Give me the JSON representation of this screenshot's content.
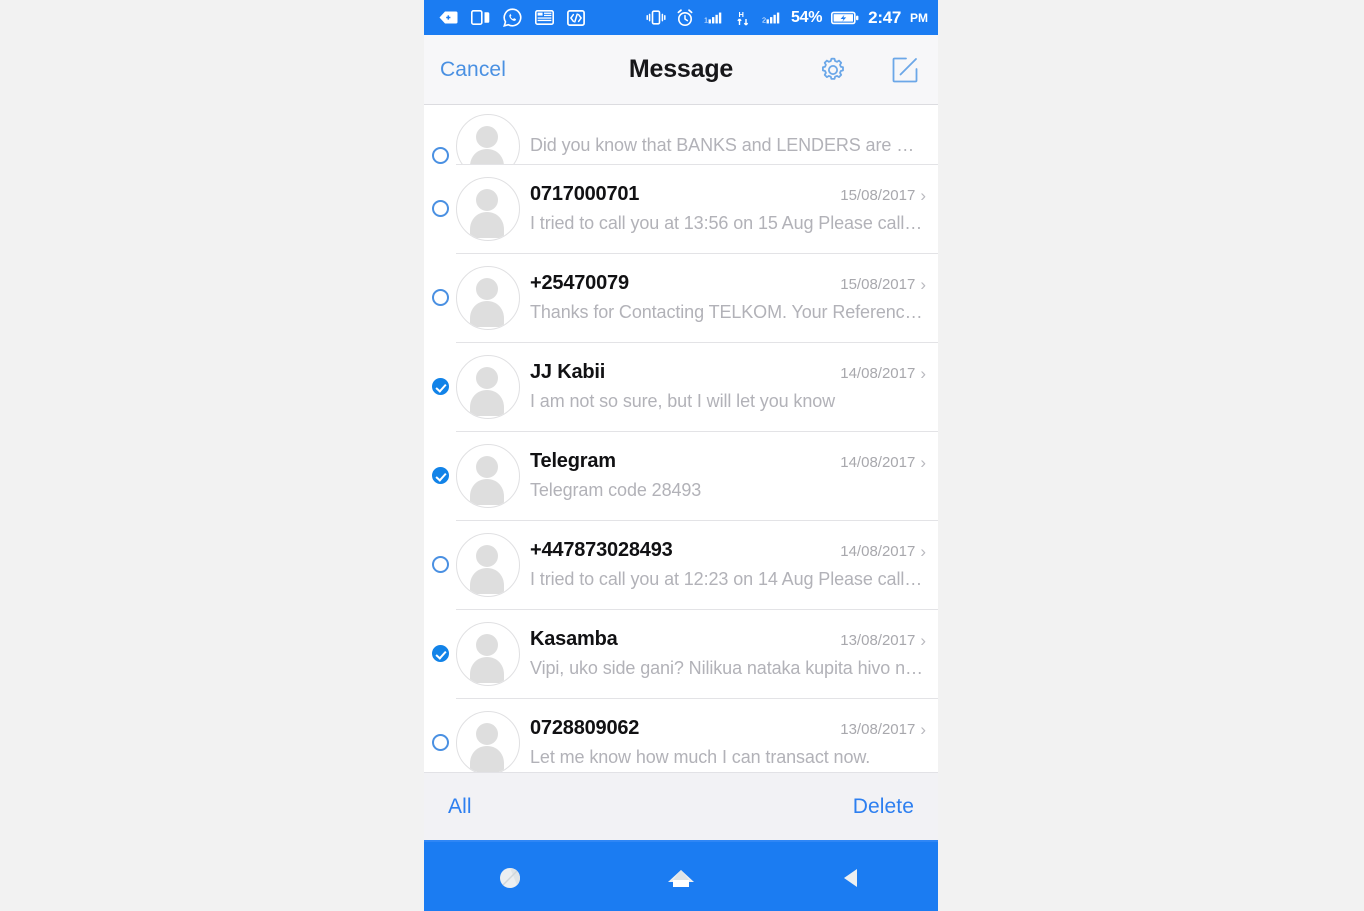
{
  "colors": {
    "status_bar_blue": "#1b7cf2",
    "accent_blue": "#2d7ff0",
    "link_blue": "#4a90e2",
    "checked_blue": "#1283e8",
    "page_bg": "#f2f2f2",
    "header_bg": "#f7f7f9",
    "toolbar_bg": "#f2f2f5",
    "snippet_gray": "#b2b2b8",
    "date_gray": "#a8a8ad"
  },
  "status_bar": {
    "left_icons": [
      "back-arrow-tag-icon",
      "split-screen-icon",
      "whatsapp-icon",
      "news-card-icon",
      "code-brackets-icon"
    ],
    "right_icons": [
      "vibrate-icon",
      "alarm-clock-icon",
      "signal-bars-sim1-icon",
      "hspa-data-icon",
      "signal-bars-sim2-icon"
    ],
    "battery_percent": "54%",
    "battery_icon": "battery-charging-icon",
    "time": "2:47",
    "ampm": "PM"
  },
  "header": {
    "cancel_label": "Cancel",
    "title": "Message",
    "settings_icon": "gear-icon",
    "compose_icon": "compose-pencil-square-icon"
  },
  "messages": [
    {
      "name": "",
      "date": "",
      "snippet": "Did you know that BANKS and LENDERS are NO…",
      "selected": false,
      "partial": true
    },
    {
      "name": "0717000701",
      "date": "15/08/2017",
      "snippet": "I tried to call you at 13:56 on 15 Aug Please call…",
      "selected": false,
      "partial": false
    },
    {
      "name": "+25470079",
      "date": "15/08/2017",
      "snippet": "Thanks for Contacting TELKOM. Your Reference…",
      "selected": false,
      "partial": false
    },
    {
      "name": "JJ Kabii",
      "date": "14/08/2017",
      "snippet": "I am not so sure, but I will let you know",
      "selected": true,
      "partial": false
    },
    {
      "name": "Telegram",
      "date": "14/08/2017",
      "snippet": "Telegram code 28493",
      "selected": true,
      "partial": false
    },
    {
      "name": "+447873028493",
      "date": "14/08/2017",
      "snippet": "I tried to call you at 12:23 on 14 Aug Please call…",
      "selected": false,
      "partial": false
    },
    {
      "name": "Kasamba",
      "date": "13/08/2017",
      "snippet": "Vipi, uko side gani? Nilikua nataka kupita hivo ni…",
      "selected": true,
      "partial": false
    },
    {
      "name": "0728809062",
      "date": "13/08/2017",
      "snippet": "Let me know how much I can transact now.",
      "selected": false,
      "partial": false
    }
  ],
  "toolbar": {
    "select_all_label": "All",
    "delete_label": "Delete"
  },
  "navbar": {
    "recents_icon": "recents-circle-icon",
    "home_icon": "home-icon",
    "back_icon": "back-triangle-icon"
  },
  "chevron_glyph": "›"
}
